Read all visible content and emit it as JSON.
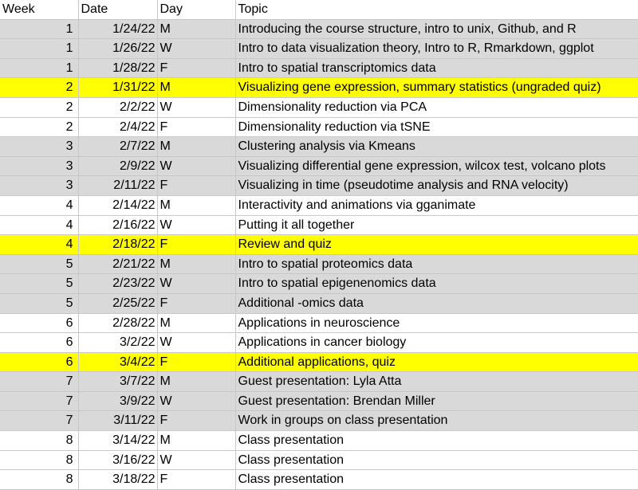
{
  "headers": [
    "Week",
    "Date",
    "Day",
    "Topic"
  ],
  "colors": {
    "gray": "#d9d9d9",
    "white": "#ffffff",
    "yellow": "#ffff00"
  },
  "rows": [
    {
      "week": "1",
      "date": "1/24/22",
      "day": "M",
      "topic": "Introducing the course structure, intro to unix, Github, and R",
      "fill": "gray"
    },
    {
      "week": "1",
      "date": "1/26/22",
      "day": "W",
      "topic": "Intro to data visualization theory, Intro to R, Rmarkdown, ggplot",
      "fill": "gray"
    },
    {
      "week": "1",
      "date": "1/28/22",
      "day": "F",
      "topic": "Intro to spatial transcriptomics data",
      "fill": "gray"
    },
    {
      "week": "2",
      "date": "1/31/22",
      "day": "M",
      "topic": "Visualizing gene expression, summary statistics (ungraded quiz)",
      "fill": "yellow"
    },
    {
      "week": "2",
      "date": "2/2/22",
      "day": "W",
      "topic": "Dimensionality reduction via PCA",
      "fill": "white"
    },
    {
      "week": "2",
      "date": "2/4/22",
      "day": "F",
      "topic": "Dimensionality reduction via tSNE",
      "fill": "white"
    },
    {
      "week": "3",
      "date": "2/7/22",
      "day": "M",
      "topic": "Clustering analysis via Kmeans",
      "fill": "gray"
    },
    {
      "week": "3",
      "date": "2/9/22",
      "day": "W",
      "topic": "Visualizing differential gene expression, wilcox test, volcano plots",
      "fill": "gray"
    },
    {
      "week": "3",
      "date": "2/11/22",
      "day": "F",
      "topic": "Visualizing in time (pseudotime analysis and RNA velocity)",
      "fill": "gray"
    },
    {
      "week": "4",
      "date": "2/14/22",
      "day": "M",
      "topic": "Interactivity and animations via gganimate",
      "fill": "white"
    },
    {
      "week": "4",
      "date": "2/16/22",
      "day": "W",
      "topic": "Putting it all together",
      "fill": "white"
    },
    {
      "week": "4",
      "date": "2/18/22",
      "day": "F",
      "topic": "Review and quiz",
      "fill": "yellow"
    },
    {
      "week": "5",
      "date": "2/21/22",
      "day": "M",
      "topic": "Intro to spatial proteomics data",
      "fill": "gray"
    },
    {
      "week": "5",
      "date": "2/23/22",
      "day": "W",
      "topic": "Intro to spatial epigenenomics data",
      "fill": "gray"
    },
    {
      "week": "5",
      "date": "2/25/22",
      "day": "F",
      "topic": "Additional -omics data",
      "fill": "gray"
    },
    {
      "week": "6",
      "date": "2/28/22",
      "day": "M",
      "topic": "Applications in neuroscience",
      "fill": "white"
    },
    {
      "week": "6",
      "date": "3/2/22",
      "day": "W",
      "topic": "Applications in cancer biology",
      "fill": "white"
    },
    {
      "week": "6",
      "date": "3/4/22",
      "day": "F",
      "topic": "Additional applications, quiz",
      "fill": "yellow"
    },
    {
      "week": "7",
      "date": "3/7/22",
      "day": "M",
      "topic": "Guest presentation: Lyla Atta",
      "fill": "gray"
    },
    {
      "week": "7",
      "date": "3/9/22",
      "day": "W",
      "topic": "Guest presentation: Brendan Miller",
      "fill": "gray"
    },
    {
      "week": "7",
      "date": "3/11/22",
      "day": "F",
      "topic": "Work in groups on class presentation",
      "fill": "gray"
    },
    {
      "week": "8",
      "date": "3/14/22",
      "day": "M",
      "topic": "Class presentation",
      "fill": "white"
    },
    {
      "week": "8",
      "date": "3/16/22",
      "day": "W",
      "topic": "Class presentation",
      "fill": "white"
    },
    {
      "week": "8",
      "date": "3/18/22",
      "day": "F",
      "topic": "Class presentation",
      "fill": "white"
    }
  ]
}
